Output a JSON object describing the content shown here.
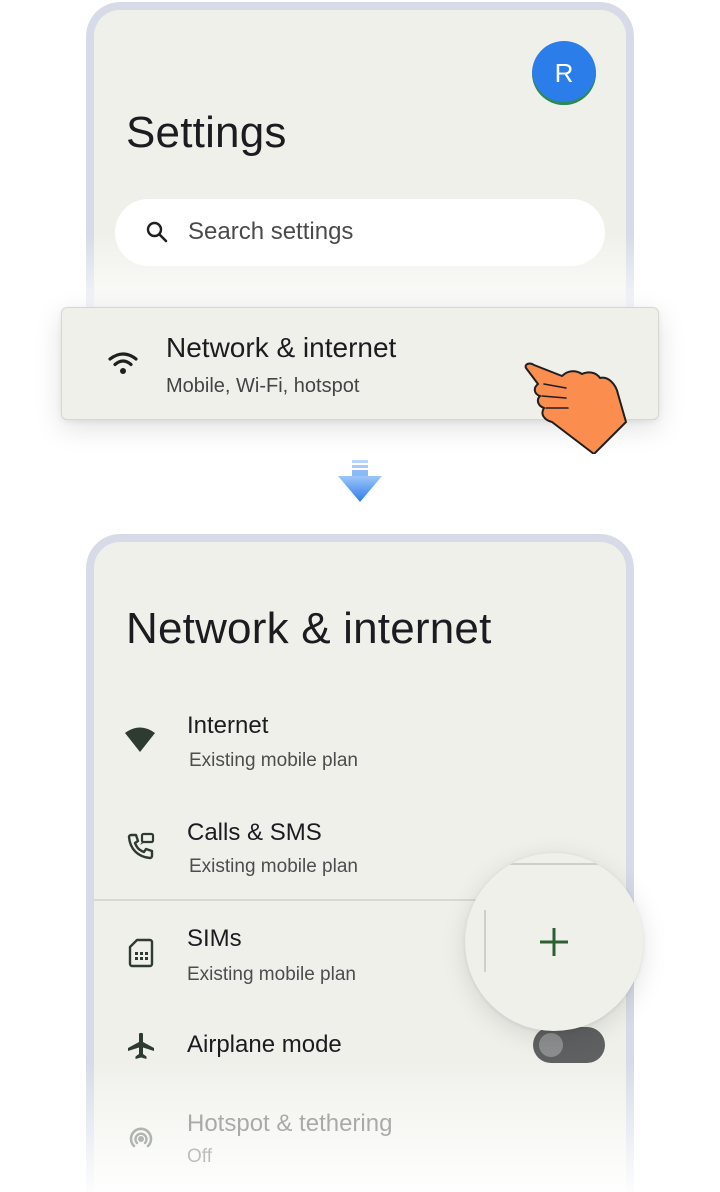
{
  "settings": {
    "avatar_letter": "R",
    "title": "Settings",
    "search_placeholder": "Search settings"
  },
  "network_card": {
    "title": "Network & internet",
    "subtitle": "Mobile, Wi-Fi, hotspot",
    "icon": "wifi-icon"
  },
  "network_page": {
    "title": "Network & internet",
    "items": [
      {
        "label": "Internet",
        "sub": "Existing mobile plan",
        "icon": "wifi-icon"
      },
      {
        "label": "Calls & SMS",
        "sub": "Existing mobile plan",
        "icon": "phone-icon"
      },
      {
        "label": "SIMs",
        "sub": "Existing mobile plan",
        "icon": "sim-card-icon"
      },
      {
        "label": "Airplane mode",
        "icon": "airplane-icon",
        "toggle_on": false
      },
      {
        "label": "Hotspot & tethering",
        "sub": "Off",
        "icon": "hotspot-icon"
      }
    ],
    "add_button_icon": "plus-icon"
  },
  "colors": {
    "accent_blue": "#2b7de9",
    "plus_green": "#2e5e33",
    "hand_orange": "#fb8d4f",
    "background": "#f0f0eb"
  }
}
